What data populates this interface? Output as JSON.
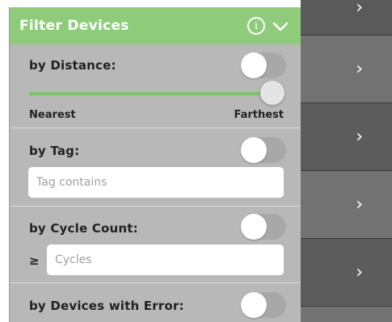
{
  "panel": {
    "title": "Filter Devices",
    "info_icon": "info-icon",
    "collapse_icon": "chevron-down-icon"
  },
  "distance": {
    "label": "by Distance:",
    "toggle_on": false,
    "slider_value": 1.0,
    "min_label": "Nearest",
    "max_label": "Farthest"
  },
  "tag": {
    "label": "by Tag:",
    "toggle_on": false,
    "placeholder": "Tag contains",
    "value": ""
  },
  "cycle_count": {
    "label": "by Cycle Count:",
    "toggle_on": false,
    "operator": "≥",
    "placeholder": "Cycles",
    "value": ""
  },
  "error": {
    "label": "by Devices with Error:",
    "toggle_on": false
  },
  "device_list": {
    "chevron": "›",
    "row_icon": "chevron-right-icon"
  },
  "colors": {
    "header": "#8ecc7c",
    "panel": "#b8b8b8",
    "slider": "#7fc070",
    "list_dark": "#5a5a5a",
    "list_light": "#707070"
  }
}
